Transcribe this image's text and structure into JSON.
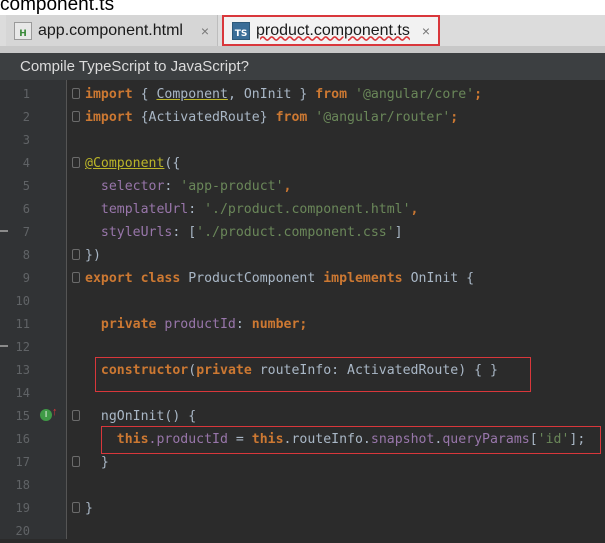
{
  "window": {
    "title_fragment": "component.ts"
  },
  "tabs": [
    {
      "label": "app.component.html",
      "icon": "html-file-icon",
      "icon_text": "H",
      "close": "×"
    },
    {
      "label": "product.component.ts",
      "icon": "ts-file-icon",
      "icon_text": "TS",
      "close": "×",
      "active": true
    }
  ],
  "banner": {
    "text": "Compile TypeScript to JavaScript?"
  },
  "editor": {
    "line_numbers": [
      "1",
      "2",
      "3",
      "4",
      "5",
      "6",
      "7",
      "8",
      "9",
      "10",
      "11",
      "12",
      "13",
      "14",
      "15",
      "16",
      "17",
      "18",
      "19",
      "20"
    ],
    "code": {
      "l1": {
        "import": "import",
        "open": " { ",
        "component": "Component",
        "comma": ", ",
        "oninit": "OnInit",
        "close": " } ",
        "from": "from",
        "space": " ",
        "module": "'@angular/core'",
        "semi": ";"
      },
      "l2": {
        "import": "import",
        "body": " {ActivatedRoute} ",
        "from": "from",
        "space": " ",
        "module": "'@angular/router'",
        "semi": ";"
      },
      "l4": {
        "decorator": "@Component",
        "rest": "({"
      },
      "l5": {
        "key": "  selector",
        "colon": ": ",
        "value": "'app-product'",
        "comma": ","
      },
      "l6": {
        "key": "  templateUrl",
        "colon": ": ",
        "value": "'./product.component.html'",
        "comma": ","
      },
      "l7": {
        "key": "  styleUrls",
        "colon": ": [",
        "value": "'./product.component.css'",
        "close": "]"
      },
      "l8": {
        "text": "})"
      },
      "l9": {
        "export": "export",
        "sp1": " ",
        "class": "class",
        "name": " ProductComponent ",
        "implements": "implements",
        "iface": " OnInit {"
      },
      "l11": {
        "indent": "  ",
        "private": "private",
        "field": " productId",
        "colon": ": ",
        "type": "number",
        "semi": ";"
      },
      "l13": {
        "indent": "  ",
        "constructor": "constructor",
        "open": "(",
        "private": "private",
        "params": " routeInfo: ActivatedRoute) { }"
      },
      "l15": {
        "indent": "  ",
        "method": "ngOnInit() {"
      },
      "l16": {
        "indent": "    ",
        "this1": "this",
        "field": ".productId",
        "mid": " = ",
        "this2": "this",
        "chain": ".routeInfo.",
        "snap": "snapshot",
        "dot": ".",
        "qp": "queryParams",
        "open": "[",
        "key": "'id'",
        "close": "];"
      },
      "l17": {
        "text": "  }"
      },
      "l19": {
        "text": "}"
      }
    },
    "gutter_marker": {
      "icon": "implements-icon",
      "text": "I",
      "arrow": "↑"
    }
  },
  "colors": {
    "keyword": "#cc7832",
    "string": "#6a8759",
    "annotation": "#bbb529",
    "field": "#9876aa",
    "plain": "#a9b7c6",
    "highlight_box": "#d9373b"
  }
}
